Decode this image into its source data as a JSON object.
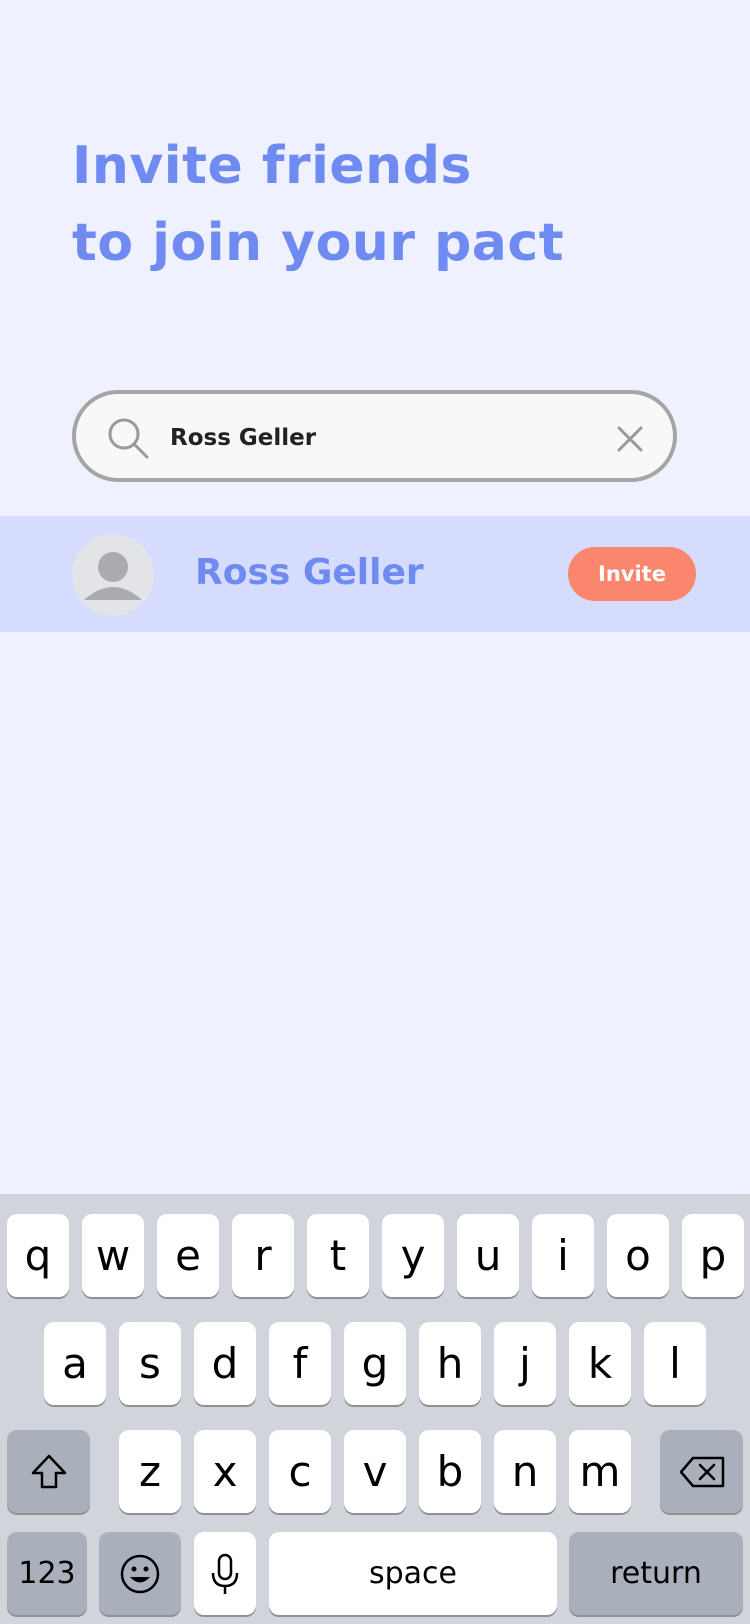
{
  "title": {
    "line1": "Invite friends",
    "line2": "to join your pact"
  },
  "search": {
    "value": "Ross Geller",
    "placeholder": ""
  },
  "results": [
    {
      "name": "Ross Geller",
      "action_label": "Invite"
    }
  ],
  "keyboard": {
    "row1": [
      "q",
      "w",
      "e",
      "r",
      "t",
      "y",
      "u",
      "i",
      "o",
      "p"
    ],
    "row2": [
      "a",
      "s",
      "d",
      "f",
      "g",
      "h",
      "j",
      "k",
      "l"
    ],
    "row3": [
      "z",
      "x",
      "c",
      "v",
      "b",
      "n",
      "m"
    ],
    "numbers_label": "123",
    "space_label": "space",
    "return_label": "return"
  },
  "colors": {
    "background": "#eff1fe",
    "accent": "#6f8bf2",
    "invite_button": "#fa876d",
    "result_row": "#d5dcfd"
  }
}
